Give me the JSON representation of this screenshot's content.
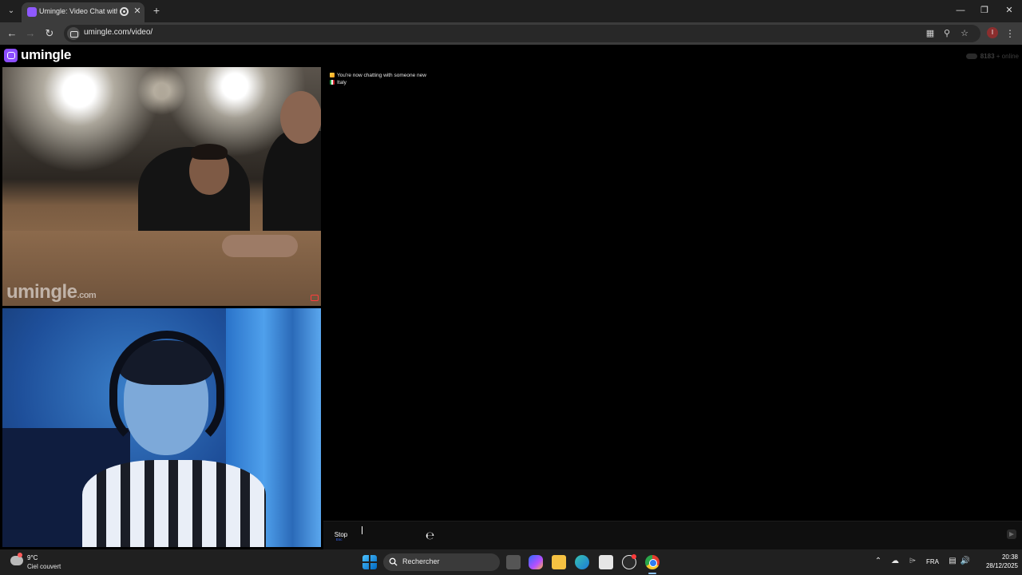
{
  "browser": {
    "tab_title": "Umingle: Video Chat with S",
    "url": "umingle.com/video/",
    "profile_initial": "I"
  },
  "site": {
    "logo_text": "umingle",
    "online_count": "8183",
    "online_suffix": "+ online",
    "watermark": "umingle",
    "watermark_suffix": ".com"
  },
  "chat": {
    "messages": [
      {
        "icon": "sparkles-icon",
        "text": "You're now chatting with someone new"
      },
      {
        "icon": "italy-flag-icon",
        "text": "Italy"
      }
    ],
    "stop_label": "Stop",
    "input_value": "",
    "input_placeholder": ""
  },
  "taskbar": {
    "weather_temp": "9°C",
    "weather_desc": "Ciel couvert",
    "search_label": "Rechercher",
    "language": "FRA",
    "time": "20:38",
    "date": "28/12/2025"
  },
  "colors": {
    "brand": "#8c4dff",
    "page_bg": "#000000",
    "report": "#ff3d3d"
  }
}
